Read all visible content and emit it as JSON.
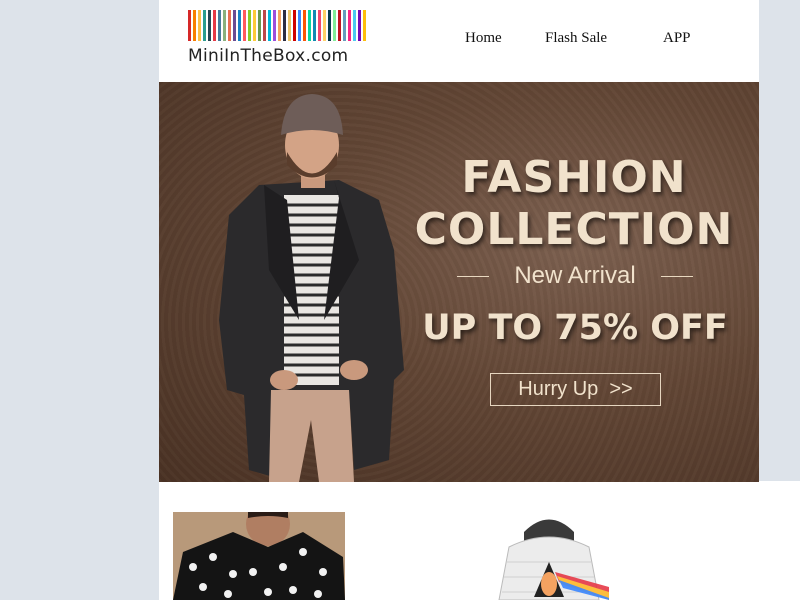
{
  "header": {
    "logo_text": "MiniInTheBox.com",
    "logo_stripe_colors": [
      "#d62828",
      "#f77f00",
      "#fcbf49",
      "#2a9d8f",
      "#264653",
      "#e63946",
      "#457b9d",
      "#8ab17d",
      "#e76f51",
      "#6a4c93",
      "#1982c4",
      "#ff595e",
      "#8ac926",
      "#ffca3a",
      "#6a994e",
      "#bc4749",
      "#00b4d8",
      "#9d4edd",
      "#f4a261",
      "#2b2d42",
      "#e9c46a",
      "#d00000",
      "#3a86ff",
      "#fb5607",
      "#06d6a0",
      "#118ab2",
      "#ef476f",
      "#ffd166",
      "#073b4c",
      "#80ed99",
      "#c1121f",
      "#669bbc",
      "#f72585",
      "#4cc9f0",
      "#7209b7",
      "#ffbe0b"
    ]
  },
  "nav": {
    "home": "Home",
    "flash_sale": "Flash Sale",
    "app": "APP"
  },
  "banner": {
    "title_line1": "FASHION",
    "title_line2": "COLLECTION",
    "subtitle": "New Arrival",
    "offer": "UP TO 75% OFF",
    "cta": "Hurry Up  >>"
  },
  "products": [
    {
      "name": "polka-dot-shirt"
    },
    {
      "name": "printed-hoodie"
    }
  ],
  "colors": {
    "page_bg": "#dde3ea",
    "banner_text": "#f1e2cc",
    "banner_bg": "#624635"
  }
}
